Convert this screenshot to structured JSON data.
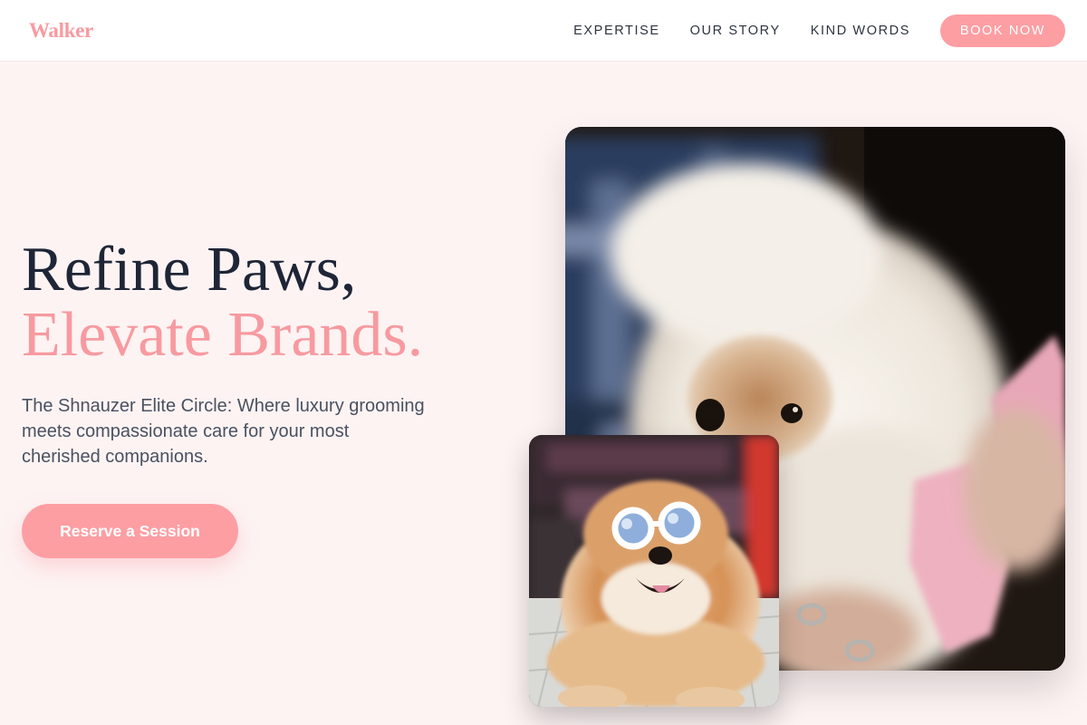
{
  "brand": {
    "name": "Walker"
  },
  "nav": {
    "links": [
      "EXPERTISE",
      "OUR STORY",
      "KIND WORDS"
    ],
    "cta_label": "BOOK NOW"
  },
  "hero": {
    "headline_line1": "Refine Paws,",
    "headline_line2": "Elevate Brands.",
    "subtitle": "The Shnauzer Elite Circle: Where luxury grooming meets compassionate care for your most cherished companions.",
    "cta_label": "Reserve a Session"
  },
  "images": {
    "main": {
      "subject": "fluffy-white-dog-with-pink-phone"
    },
    "small": {
      "subject": "fluffy-dog-wearing-white-sunglasses"
    }
  },
  "colors": {
    "accent": "#fd9ea3",
    "accent_text": "#f79aa0",
    "heading": "#1e2536",
    "body_text": "#4a5160",
    "page_bg": "#fdf3f3"
  }
}
